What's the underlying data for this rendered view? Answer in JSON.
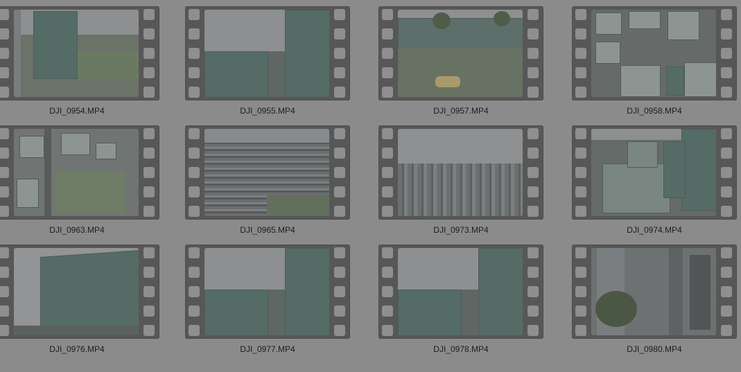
{
  "files": [
    {
      "name": "DJI_0954.MP4",
      "scene": "tower-left"
    },
    {
      "name": "DJI_0955.MP4",
      "scene": "tower-right"
    },
    {
      "name": "DJI_0957.MP4",
      "scene": "lawn-robot"
    },
    {
      "name": "DJI_0958.MP4",
      "scene": "topdown-roofs"
    },
    {
      "name": "DJI_0963.MP4",
      "scene": "topdown-field"
    },
    {
      "name": "DJI_0965.MP4",
      "scene": "city-sprawl"
    },
    {
      "name": "DJI_0973.MP4",
      "scene": "city-haze"
    },
    {
      "name": "DJI_0974.MP4",
      "scene": "blocks-aerial"
    },
    {
      "name": "DJI_0976.MP4",
      "scene": "tower-closeup"
    },
    {
      "name": "DJI_0977.MP4",
      "scene": "tower-right"
    },
    {
      "name": "DJI_0978.MP4",
      "scene": "tower-right"
    },
    {
      "name": "DJI_0980.MP4",
      "scene": "interior-plant"
    }
  ],
  "colors": {
    "background": "#8b8b8b",
    "film_strip": "#575757",
    "label_text": "#1d1d1d"
  }
}
